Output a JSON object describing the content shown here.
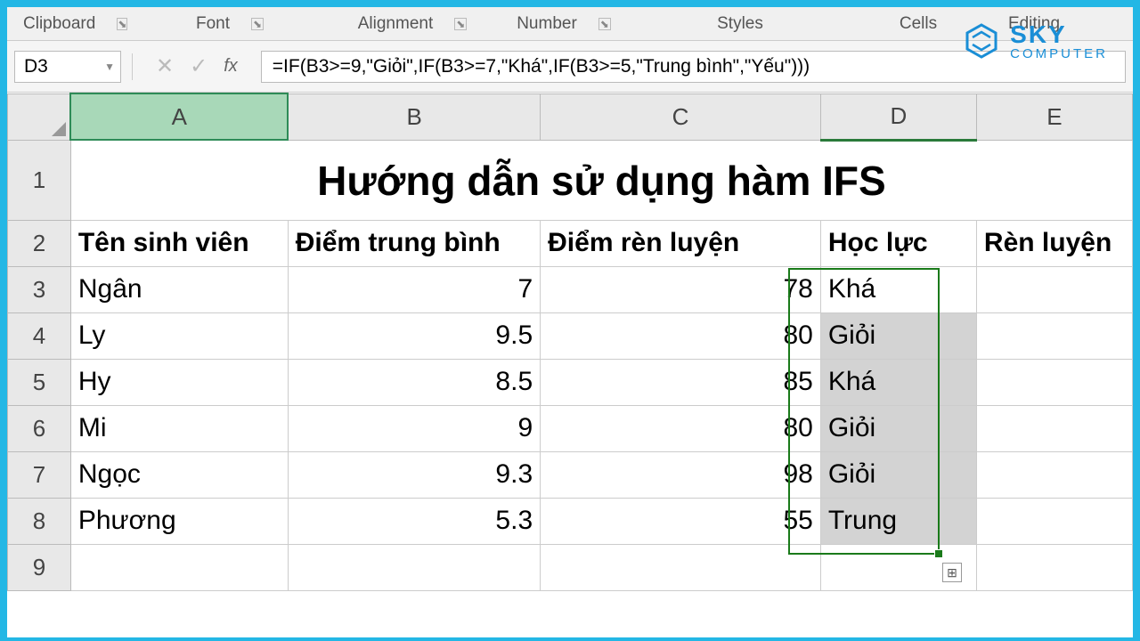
{
  "ribbon": {
    "groups": [
      "Clipboard",
      "Font",
      "Alignment",
      "Number",
      "Styles",
      "Cells",
      "Editing"
    ]
  },
  "namebox": "D3",
  "formula": "=IF(B3>=9,\"Giỏi\",IF(B3>=7,\"Khá\",IF(B3>=5,\"Trung bình\",\"Yếu\")))",
  "cols": [
    "A",
    "B",
    "C",
    "D",
    "E"
  ],
  "title": "Hướng dẫn sử dụng hàm IFS",
  "headers": {
    "a": "Tên sinh viên",
    "b": "Điểm trung bình",
    "c": "Điểm rèn luyện",
    "d": "Học lực",
    "e": "Rèn luyện"
  },
  "rows": [
    {
      "n": "3",
      "a": "Ngân",
      "b": "7",
      "c": "78",
      "d": "Khá",
      "e": ""
    },
    {
      "n": "4",
      "a": "Ly",
      "b": "9.5",
      "c": "80",
      "d": "Giỏi",
      "e": ""
    },
    {
      "n": "5",
      "a": "Hy",
      "b": "8.5",
      "c": "85",
      "d": "Khá",
      "e": ""
    },
    {
      "n": "6",
      "a": "Mi",
      "b": "9",
      "c": "80",
      "d": "Giỏi",
      "e": ""
    },
    {
      "n": "7",
      "a": "Ngọc",
      "b": "9.3",
      "c": "98",
      "d": "Giỏi",
      "e": ""
    },
    {
      "n": "8",
      "a": "Phương",
      "b": "5.3",
      "c": "55",
      "d": "Trung",
      "e": ""
    }
  ],
  "logo": {
    "brand": "SKY",
    "sub": "COMPUTER"
  }
}
